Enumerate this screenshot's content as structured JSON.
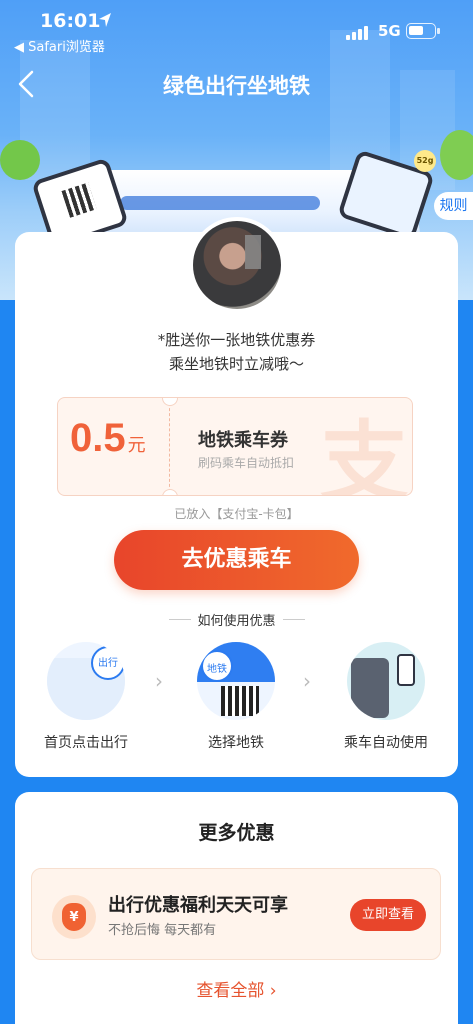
{
  "status_bar": {
    "time": "16:01",
    "back_app": "◀ Safari浏览器",
    "network": "5G"
  },
  "nav": {
    "title": "绿色出行坐地铁",
    "rules": "规则"
  },
  "hero": {
    "coin_label": "52g"
  },
  "gift": {
    "line1": "*胜送你一张地铁优惠券",
    "line2": "乘坐地铁时立减哦～"
  },
  "coupon": {
    "amount": "0.5",
    "unit": "元",
    "title": "地铁乘车券",
    "subtitle": "刷码乘车自动抵扣",
    "watermark": "支",
    "placed_note": "已放入【支付宝-卡包】"
  },
  "cta": {
    "label": "去优惠乘车"
  },
  "howto": {
    "title": "如何使用优惠",
    "steps": [
      {
        "label": "首页点击出行",
        "badge": "出行"
      },
      {
        "label": "选择地铁",
        "badge": "地铁"
      },
      {
        "label": "乘车自动使用"
      }
    ]
  },
  "more": {
    "title": "更多优惠",
    "offer": {
      "icon_glyph": "¥",
      "title": "出行优惠福利天天可享",
      "subtitle": "不抢后悔 每天都有",
      "button": "立即查看"
    },
    "view_all": "查看全部 ›"
  },
  "colors": {
    "brand_blue": "#1f86f2",
    "accent_orange": "#e8452b"
  }
}
